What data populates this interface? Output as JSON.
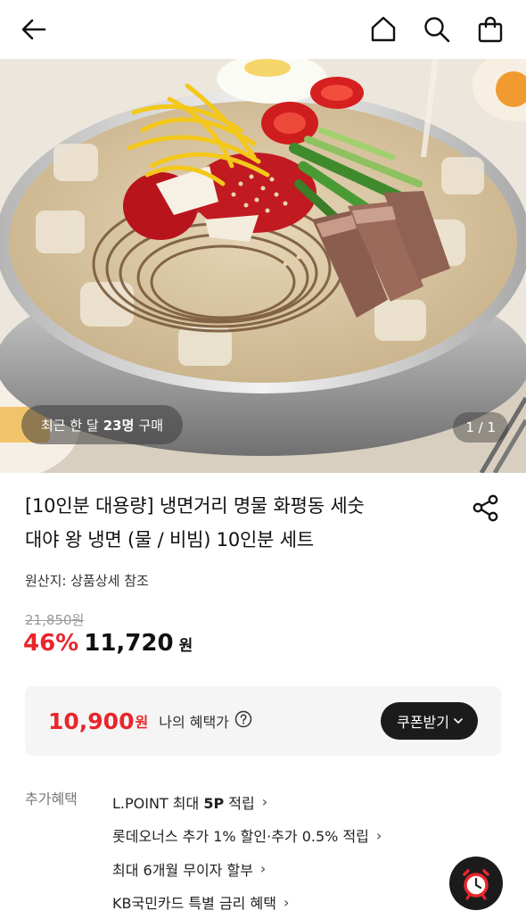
{
  "nav": {
    "back_icon": "arrow-left-icon",
    "home_icon": "home-icon",
    "search_icon": "search-icon",
    "cart_icon": "shopping-bag-icon"
  },
  "hero": {
    "badge_prefix": "최근 한 달",
    "badge_count": "23명",
    "badge_suffix": "구매",
    "pager": "1 / 1"
  },
  "product": {
    "title_line1": "[10인분 대용량] 냉면거리 명물 화평동 세숫",
    "title_line2": "대야 왕 냉면 (물 / 비빔) 10인분 세트",
    "share_icon": "share-icon",
    "origin": "원산지: 상품상세 참조",
    "original_price": "21,850원",
    "discount": "46%",
    "price": "11,720",
    "price_unit": "원"
  },
  "benefit": {
    "price": "10,900",
    "price_unit": "원",
    "label": "나의 혜택가",
    "coupon_button": "쿠폰받기"
  },
  "extra": {
    "label": "추가혜택",
    "items": [
      {
        "pre": "L.POINT 최대 ",
        "bold": "5P",
        "post": " 적립"
      },
      {
        "pre": "롯데오너스 추가 1% 할인·추가 0.5% 적립",
        "bold": "",
        "post": ""
      },
      {
        "pre": "최대 6개월 무이자 할부",
        "bold": "",
        "post": ""
      },
      {
        "pre": "KB국민카드 특별 금리 혜택",
        "bold": "",
        "post": ""
      }
    ]
  },
  "colors": {
    "accent_red": "#e8262c",
    "dark_button": "#1b1b1b",
    "box_bg": "#f5f5f5"
  }
}
